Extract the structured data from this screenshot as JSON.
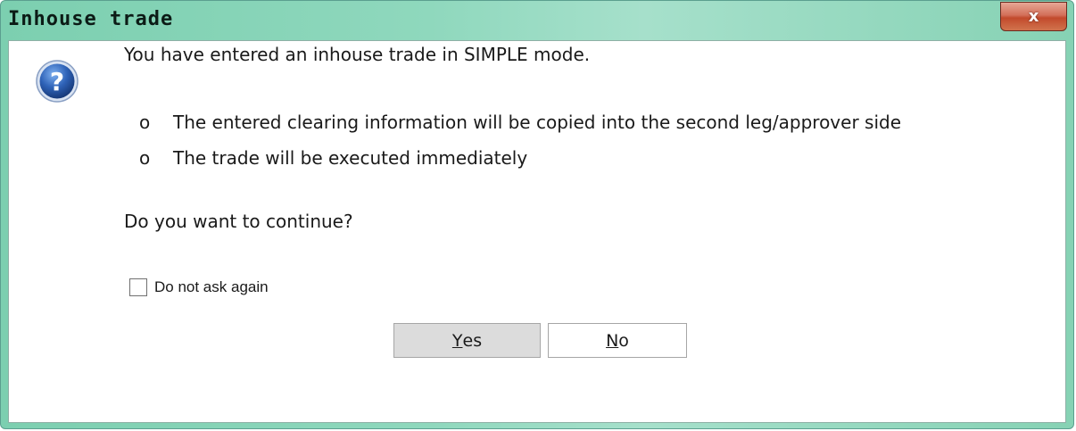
{
  "window": {
    "title": "Inhouse trade",
    "close_glyph": "x"
  },
  "message": {
    "icon": "question-icon",
    "line1": "You have entered an inhouse trade in SIMPLE mode.",
    "bullet_mark": "o",
    "bullets": [
      "The entered clearing information will be copied into the second leg/approver side",
      "The trade will be executed immediately"
    ],
    "question": "Do you want to continue?"
  },
  "options": {
    "do_not_ask_label": "Do not ask again",
    "do_not_ask_checked": false
  },
  "buttons": {
    "yes_mnemonic": "Y",
    "yes_rest": "es",
    "no_mnemonic": "N",
    "no_rest": "o"
  },
  "colors": {
    "titlebar": "#8fd8bd",
    "close_button": "#c24a2c",
    "question_icon": "#2f63b8"
  }
}
